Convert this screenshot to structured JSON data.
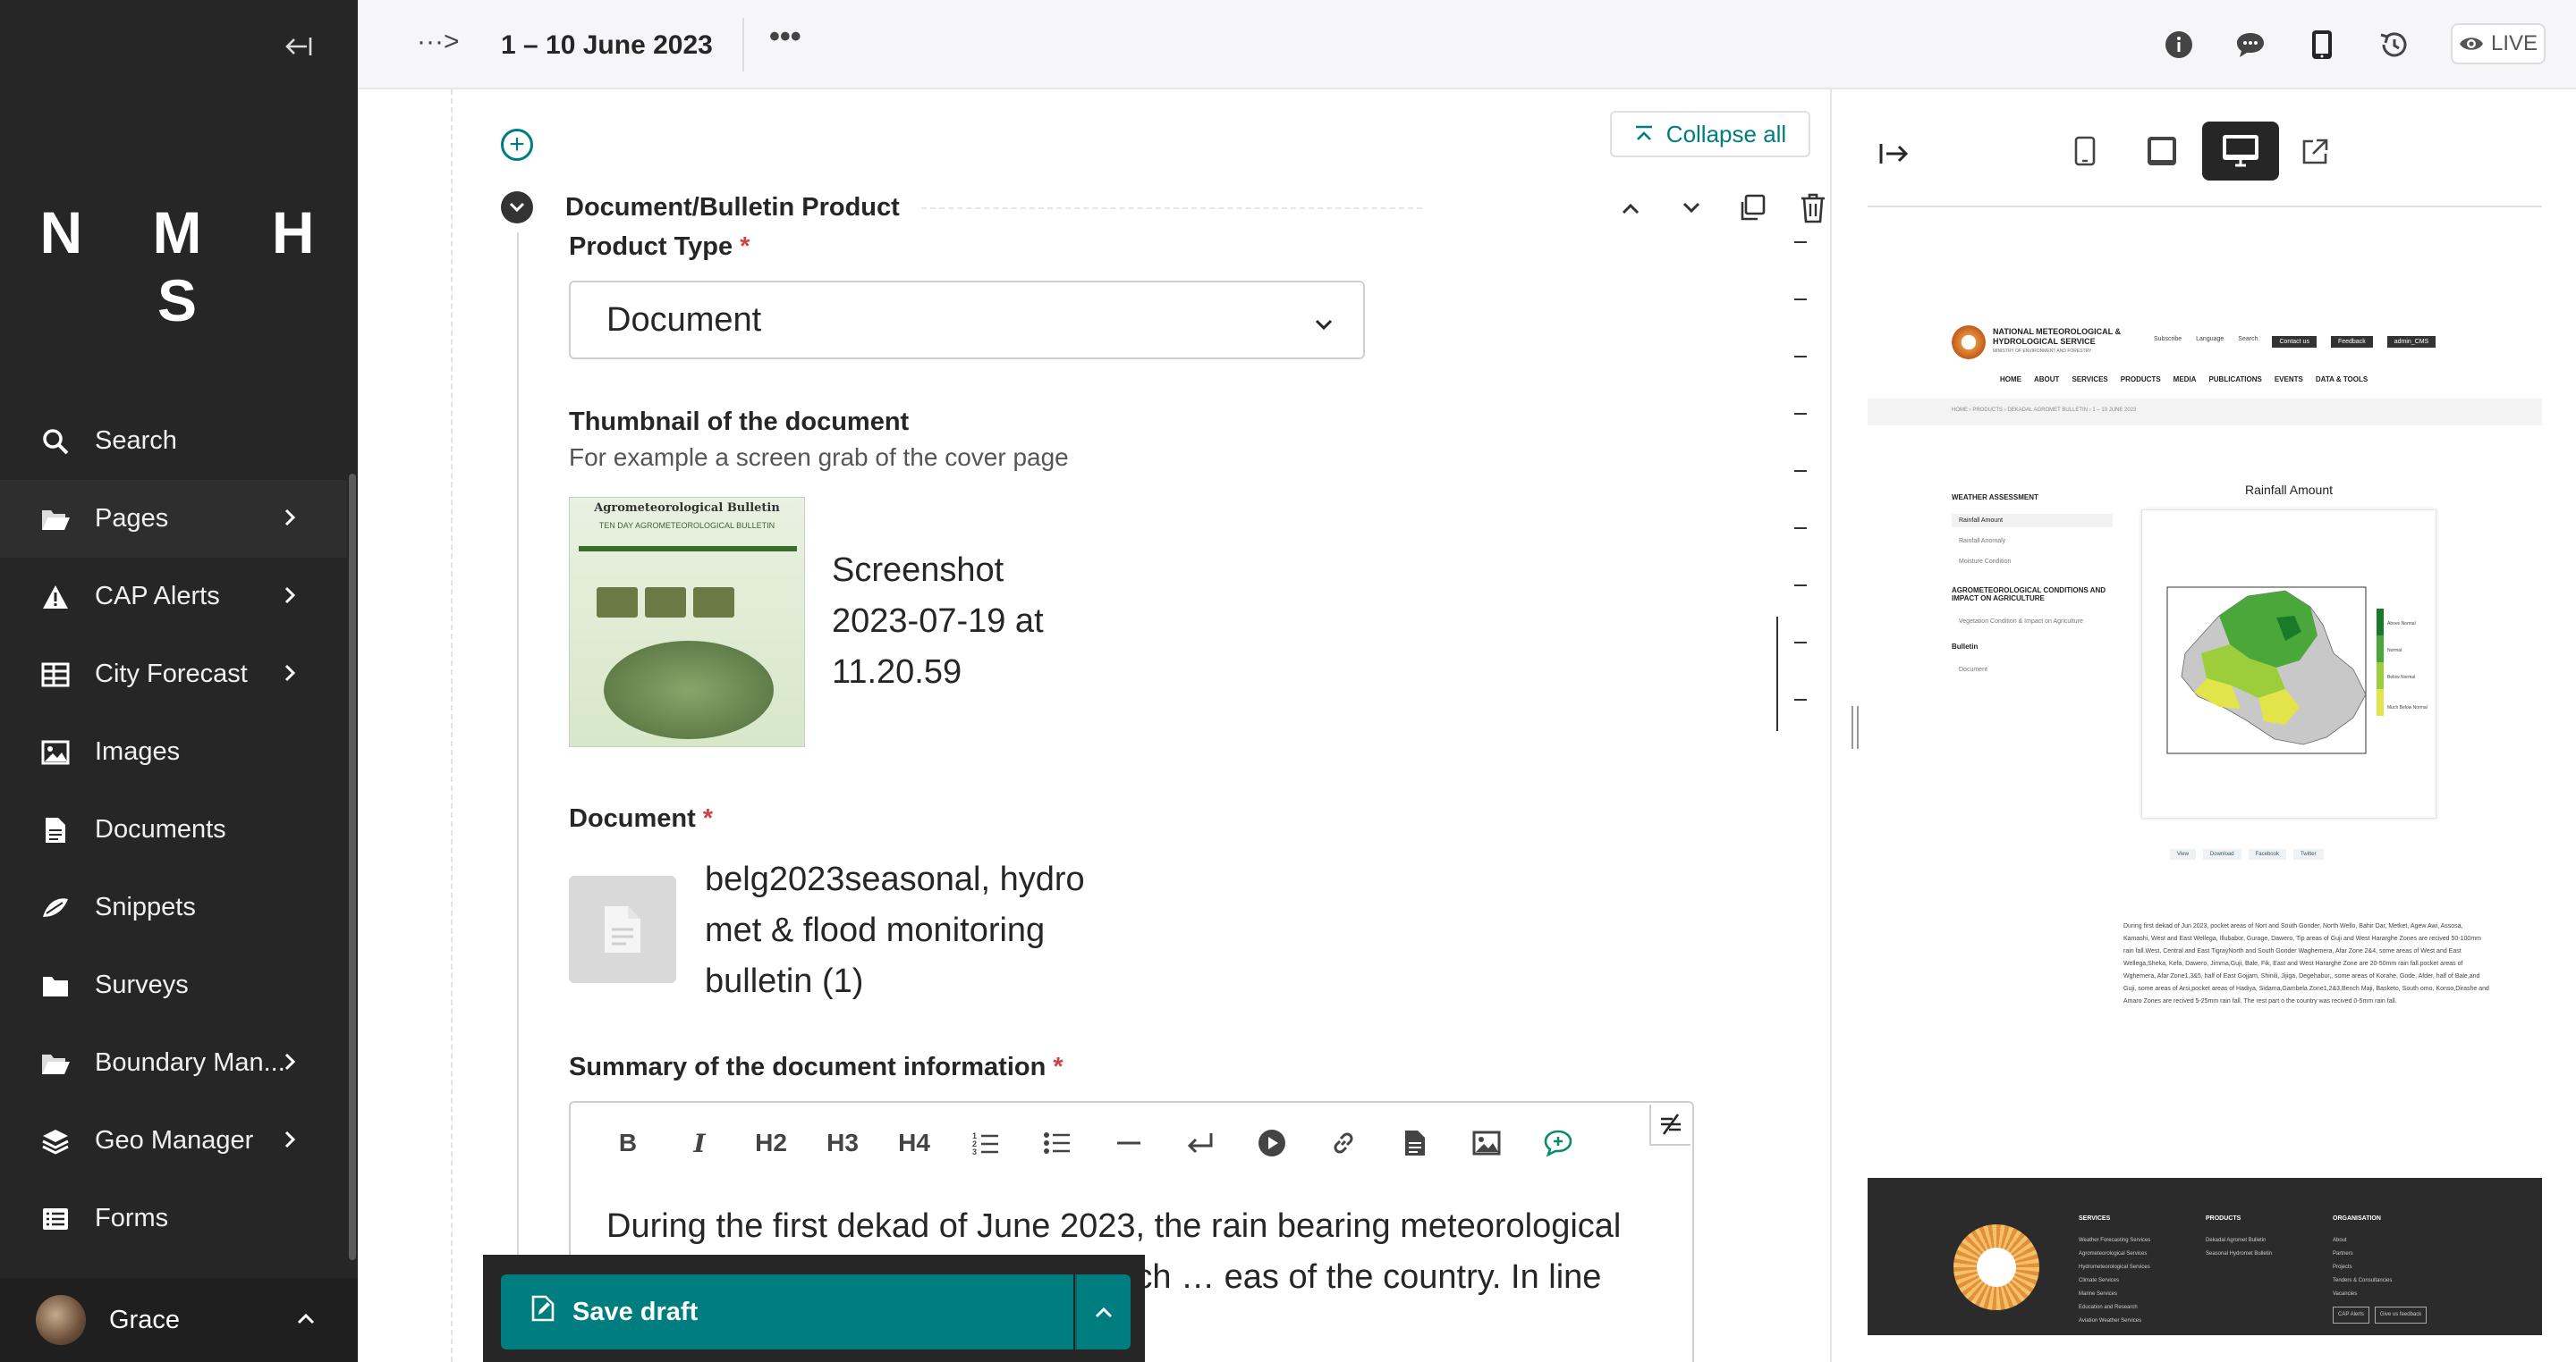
{
  "sidebar": {
    "logo": "N M H S",
    "items": [
      {
        "label": "Search",
        "icon": "search-icon"
      },
      {
        "label": "Pages",
        "icon": "folder-open-icon",
        "has_children": true
      },
      {
        "label": "CAP Alerts",
        "icon": "warning-icon",
        "has_children": true
      },
      {
        "label": "City Forecast",
        "icon": "table-icon",
        "has_children": true
      },
      {
        "label": "Images",
        "icon": "image-icon"
      },
      {
        "label": "Documents",
        "icon": "document-icon"
      },
      {
        "label": "Snippets",
        "icon": "snippet-icon"
      },
      {
        "label": "Surveys",
        "icon": "folder-icon"
      },
      {
        "label": "Boundary Man...",
        "icon": "folder-open-icon",
        "has_children": true
      },
      {
        "label": "Geo Manager",
        "icon": "layers-icon",
        "has_children": true
      },
      {
        "label": "Forms",
        "icon": "list-icon"
      }
    ],
    "account": {
      "name": "Grace"
    }
  },
  "header": {
    "breadcrumb_toggle": "···>",
    "title": "1 – 10 June 2023",
    "more": "•••",
    "live": "LIVE"
  },
  "editor": {
    "collapse_all": "Collapse all",
    "block_title": "Document/Bulletin Product",
    "product_type": {
      "label": "Product Type",
      "value": "Document"
    },
    "thumbnail": {
      "label": "Thumbnail of the document",
      "help": "For example a screen grab of the cover page",
      "file_name": "Screenshot 2023-07-19 at 11.20.59",
      "thumb_title": "Agrometeorological Bulletin",
      "thumb_sub": "TEN DAY AGROMETEOROLOGICAL BULLETIN"
    },
    "document": {
      "label": "Document",
      "file_name": "belg2023seasonal, hydro met & flood monitoring bulletin (1)"
    },
    "summary": {
      "label": "Summary of the document information",
      "toolbar": [
        "B",
        "I",
        "H2",
        "H3",
        "H4"
      ],
      "text": "During the first dekad of June 2023, the rain bearing meteorological … amount and distribution over much … eas of the country. In line with this"
    },
    "required_mark": "*",
    "save": {
      "label": "Save draft"
    }
  },
  "preview": {
    "site": {
      "org_name": "NATIONAL METEOROLOGICAL & HYDROLOGICAL SERVICE",
      "org_tag": "MINISTRY OF ENVIRONMENT AND FORESTRY",
      "top_links": [
        "Subscribe",
        "Language",
        "Search",
        "Contact us",
        "Feedback",
        "admin_CMS"
      ],
      "menu": [
        "HOME",
        "ABOUT",
        "SERVICES",
        "PRODUCTS",
        "MEDIA",
        "PUBLICATIONS",
        "EVENTS",
        "DATA & TOOLS"
      ],
      "breadcrumb": "HOME  ›  PRODUCTS  ›  DEKADAL AGROMET BULLETIN  ›  1 – 10 JUNE 2023",
      "side_heading_1": "WEATHER ASSESSMENT",
      "side_items_1": [
        "Rainfall Amount",
        "Rainfall Anomaly",
        "Moisture Condition"
      ],
      "side_heading_2": "AGROMETEOROLOGICAL CONDITIONS AND IMPACT ON AGRICULTURE",
      "side_items_2": [
        "Vegetation Condition & Impact on Agriculture"
      ],
      "side_heading_3": "Bulletin",
      "side_items_3": [
        "Document"
      ],
      "map_title": "Rainfall Amount",
      "map_legend": [
        "Above Normal",
        "Normal",
        "Below Normal",
        "Much Below Normal"
      ],
      "share": [
        "View",
        "Download",
        "Facebook",
        "Twitter"
      ],
      "body": "During first dekad of Jun 2023, pocket areas of Nort and South Gonder, North Wello, Bahir Dar, Metket, Agew Awi, Assosa, Kamashi, West and East Wellega, Illubabor, Gurage, Dawero, Tip areas of Guji and West Hararghe Zones are recived 50-100mm rain fall.West, Central and East TigrayNorth and South Gonder Waghemera, Afar Zone 2&4, some areas of West and East Wellega,Sheka, Kefa, Dawero, Jimma,Guji, Bale, Fik, East and West Hararghe Zone are 20-50mm rain fall.pocket areas of Wghemera, Afar Zone1,3&5, half of East Gojjam, Shinili, Jijiga, Degehabur,, some areas of Korahe, Gode, Afder, half of Bale,and Guji, some areas of Arsi,pocket areas of Hadiya, Sidama,Gambela Zone1,2&3,Bench Maji, Basketo, South omo, Konso,Dirashe and Amaro Zones are recived 5-25mm rain fall. The rest part o the country was recived 0-5mm rain fall.",
      "footer": {
        "services_h": "SERVICES",
        "services": [
          "Weather Forecasting Services",
          "Agrometeorological Services",
          "Hydrometeorological Services",
          "Climate Services",
          "Marine Services",
          "Education and Research",
          "Aviation Weather Services"
        ],
        "products_h": "PRODUCTS",
        "products": [
          "Dekadal Agromet Bulletin",
          "Seasonal Hydromet Bulletin"
        ],
        "org_h": "ORGANISATION",
        "org": [
          "About",
          "Partners",
          "Projects",
          "Tenders & Consultancies",
          "Vacancies"
        ],
        "buttons": [
          "CAP Alerts",
          "Give us feedback"
        ]
      }
    }
  },
  "colors": {
    "sidebar": "#262626",
    "accent": "#007d7e",
    "required": "#cd4444"
  }
}
